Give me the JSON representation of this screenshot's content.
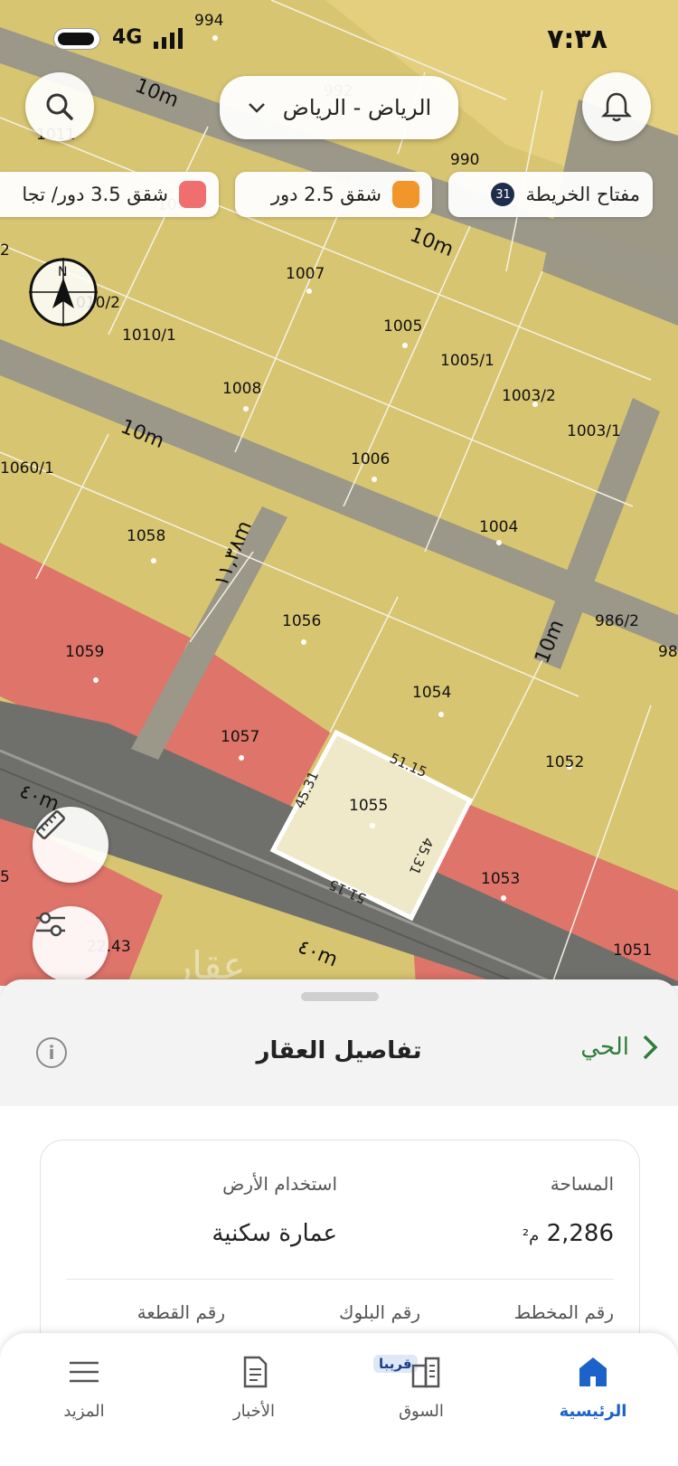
{
  "status": {
    "network": "4G",
    "time": "٧:٣٨"
  },
  "header": {
    "city": "الرياض - الرياض"
  },
  "legend": {
    "map_key_label": "مفتاح الخريطة",
    "map_key_badge": "31",
    "items": [
      {
        "label": "شقق 2.5 دور",
        "color": "#f0962b"
      },
      {
        "label": "شقق 3.5 دور/ تجا",
        "color": "#f06e6e"
      }
    ]
  },
  "map": {
    "roads": [
      "10m",
      "10m",
      "10m",
      "10m",
      "١١,٣٨m",
      "٤٠m",
      "٤٠m"
    ],
    "compass": "N",
    "parcels": [
      "994",
      "992",
      "990",
      "1011",
      "1007",
      "1005",
      "1005/1",
      "1003/2",
      "1003/1",
      "1010/1",
      "1008",
      "1006",
      "1004",
      "1060/1",
      "1058",
      "1056",
      "1054",
      "986/2",
      "1059",
      "1057",
      "1055",
      "1052",
      "1053",
      "1051",
      "22.43"
    ],
    "edge_fragments": [
      "2",
      "010/2",
      "10",
      "98",
      "5"
    ],
    "dimensions": [
      "51.15",
      "45.31",
      "45.31",
      "51.15"
    ],
    "watermark": "عقار"
  },
  "sheet": {
    "title": "تفاصيل العقار",
    "neighborhood": "الحي",
    "area_label": "المساحة",
    "area_value": "2,286",
    "area_unit": "م²",
    "land_use_label": "استخدام الأرض",
    "land_use_value": "عمارة سكنية",
    "plan_label": "رقم المخطط",
    "block_label": "رقم البلوك",
    "plot_label": "رقم القطعة"
  },
  "nav": {
    "home": "الرئيسية",
    "market": "السوق",
    "soon": "قريبا",
    "news": "الأخبار",
    "more": "المزيد"
  },
  "colors": {
    "accent": "#1c63c9",
    "green": "#2f7d3a"
  }
}
